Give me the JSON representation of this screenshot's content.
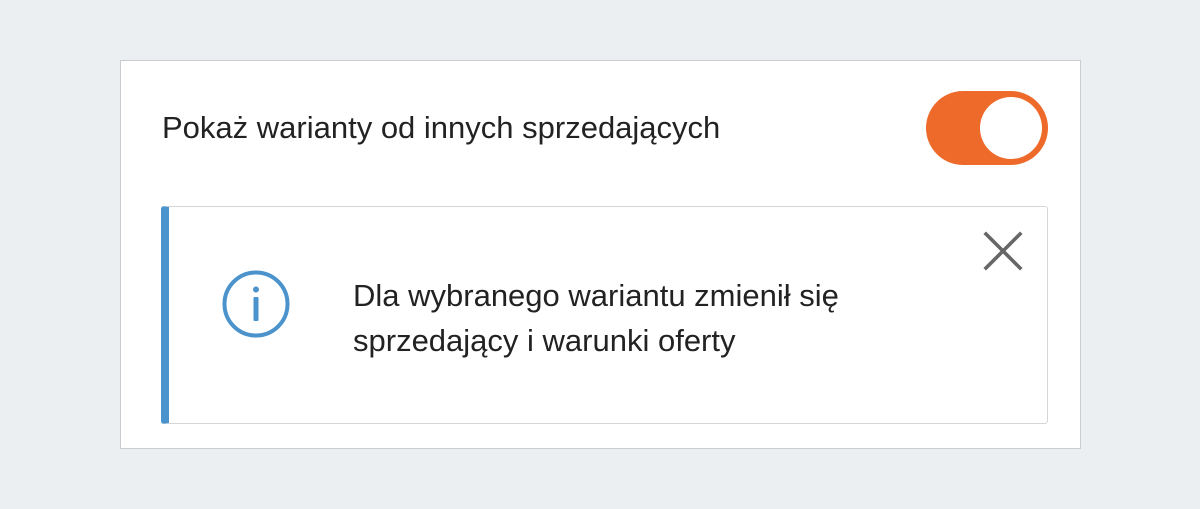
{
  "setting": {
    "label": "Pokaż warianty od innych sprzedających",
    "toggle_on": true
  },
  "notice": {
    "icon": "info-icon",
    "message": "Dla wybranego wariantu zmienił się sprzedający i warunki oferty",
    "close_icon": "close-icon"
  },
  "colors": {
    "background": "#eceff2",
    "card_border": "#c9ccd0",
    "toggle_on": "#ee6a2a",
    "info_accent": "#4a93cc",
    "text": "#222222",
    "close_icon": "#666666"
  }
}
